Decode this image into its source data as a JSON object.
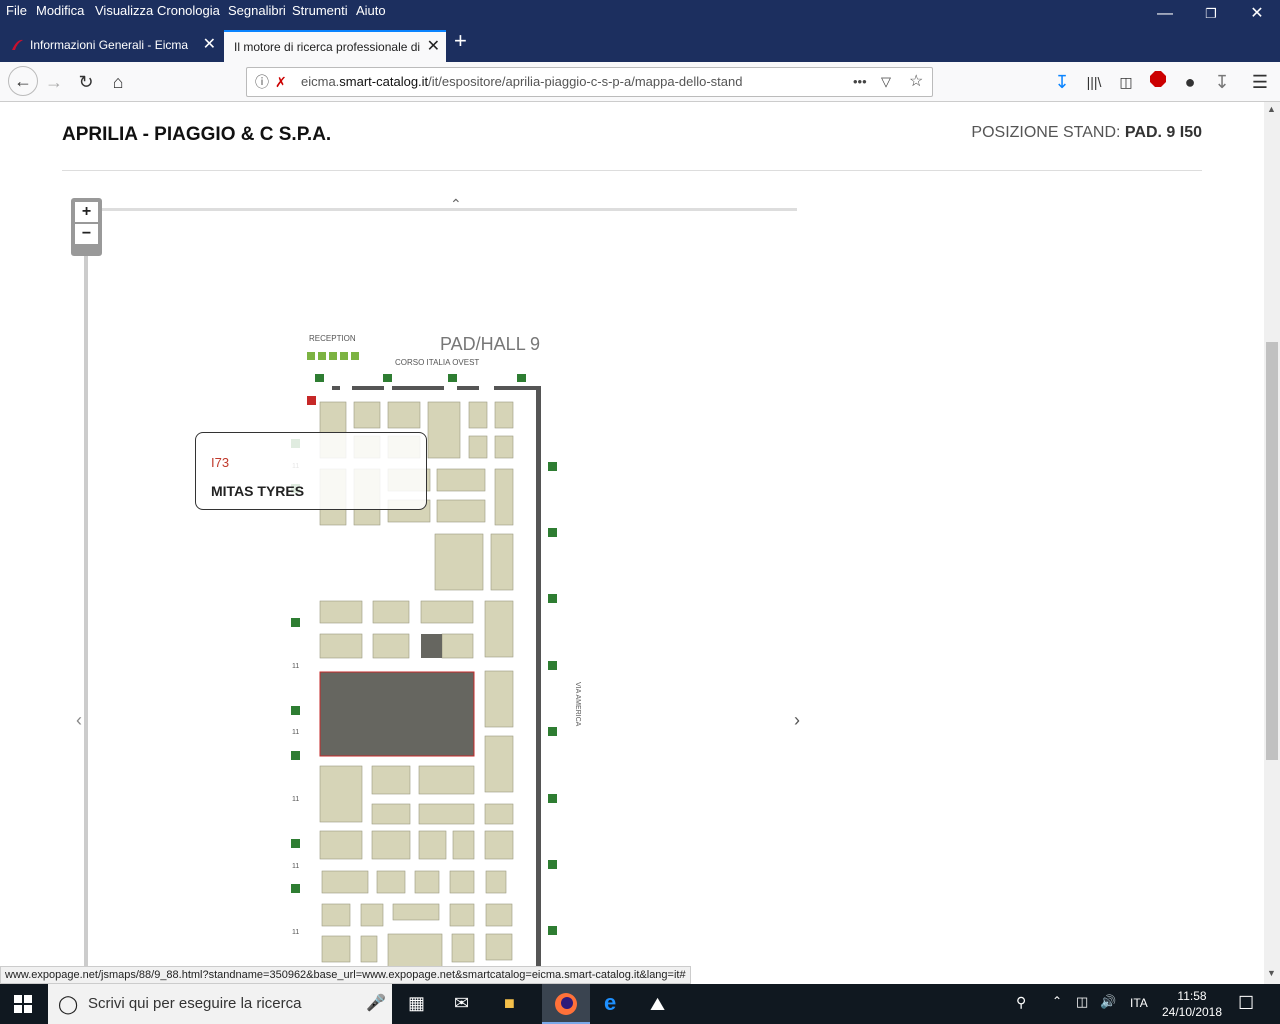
{
  "menubar": {
    "items": [
      "File",
      "Modifica",
      "Visualizza",
      "Cronologia",
      "Segnalibri",
      "Strumenti",
      "Aiuto"
    ]
  },
  "tabs": [
    {
      "label": "Informazioni Generali - Eicma"
    },
    {
      "label": "Il motore di ricerca professionale di"
    }
  ],
  "urlbar": {
    "prefix": "eicma.",
    "domain": "smart-catalog.it",
    "path": "/it/espositore/aprilia-piaggio-c-s-p-a/mappa-dello-stand"
  },
  "page": {
    "exhibitor": "APRILIA - PIAGGIO & C S.P.A.",
    "stand_label": "POSIZIONE STAND:",
    "stand_value": "PAD. 9 I50"
  },
  "map": {
    "zoom_in": "+",
    "zoom_out": "−",
    "hall_title": "PAD/HALL 9",
    "reception": "RECEPTION",
    "corso": "CORSO ITALIA OVEST",
    "via": "VIA AMERICA",
    "row_number": "11",
    "tooltip": {
      "code": "I73",
      "name": "MITAS TYRES"
    }
  },
  "statusbar": {
    "text": "www.expopage.net/jsmaps/88/9_88.html?standname=350962&base_url=www.expopage.net&smartcatalog=eicma.smart-catalog.it&lang=it#"
  },
  "taskbar": {
    "search_placeholder": "Scrivi qui per eseguire la ricerca",
    "lang": "ITA",
    "time": "11:58",
    "date": "24/10/2018"
  }
}
